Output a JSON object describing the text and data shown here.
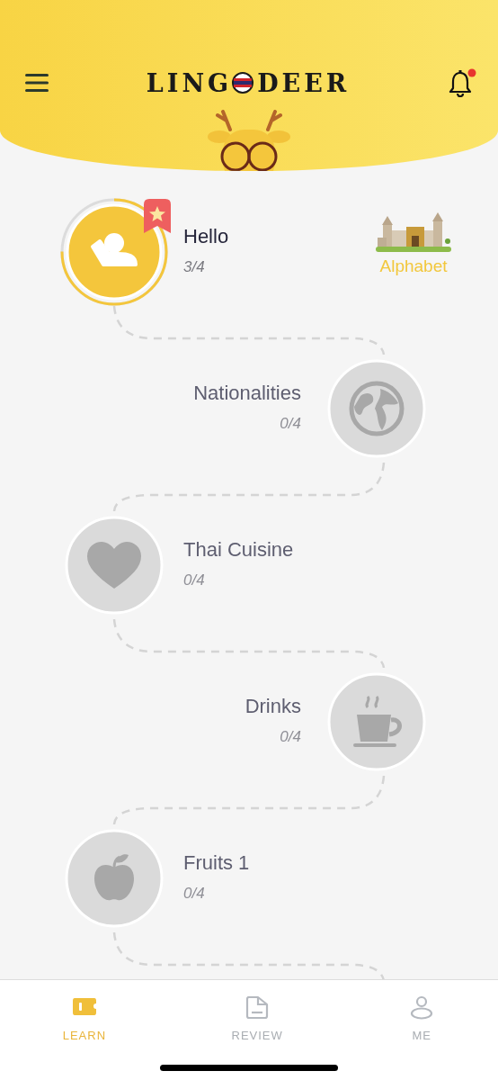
{
  "header": {
    "logo_left": "LING",
    "logo_right": "DEER",
    "notification": true
  },
  "lessons": [
    {
      "title": "Hello",
      "progress": "3/4",
      "kind": "person",
      "locked": false,
      "level": 0.75,
      "starred": true
    },
    {
      "title": "Nationalities",
      "progress": "0/4",
      "kind": "globe",
      "locked": true
    },
    {
      "title": "Thai Cuisine",
      "progress": "0/4",
      "kind": "heart",
      "locked": true
    },
    {
      "title": "Drinks",
      "progress": "0/4",
      "kind": "cup",
      "locked": true
    },
    {
      "title": "Fruits 1",
      "progress": "0/4",
      "kind": "apple",
      "locked": true
    }
  ],
  "alphabet": {
    "label": "Alphabet"
  },
  "tabs": [
    {
      "label": "LEARN",
      "kind": "learn",
      "selected": true
    },
    {
      "label": "REVIEW",
      "kind": "folder",
      "selected": false
    },
    {
      "label": "ME",
      "kind": "person",
      "selected": false
    }
  ]
}
